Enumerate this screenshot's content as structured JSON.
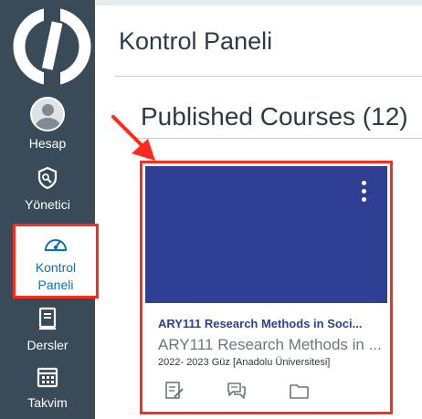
{
  "sidebar": {
    "background": "#394b58",
    "items": [
      {
        "label": "Hesap",
        "icon": "avatar"
      },
      {
        "label": "Yönetici",
        "icon": "shield-icon"
      },
      {
        "label": "Kontrol Paneli",
        "icon": "speedometer-icon",
        "active": true
      },
      {
        "label": "Dersler",
        "icon": "book-icon"
      },
      {
        "label": "Takvim",
        "icon": "calendar-icon"
      }
    ]
  },
  "header": {
    "title": "Kontrol Paneli"
  },
  "main": {
    "section_title": "Published Courses (12)",
    "highlight_color": "#ff2b1c",
    "cards": [
      {
        "color": "#2f3f93",
        "title": "ARY111 Research Methods in Soci...",
        "name": "ARY111 Research Methods in ...",
        "term": "2022- 2023 Güz [Anadolu Üniversitesi]",
        "menu_icon": "kebab-menu-icon",
        "actions": [
          "assignments-icon",
          "discussions-icon",
          "files-icon"
        ]
      }
    ]
  }
}
